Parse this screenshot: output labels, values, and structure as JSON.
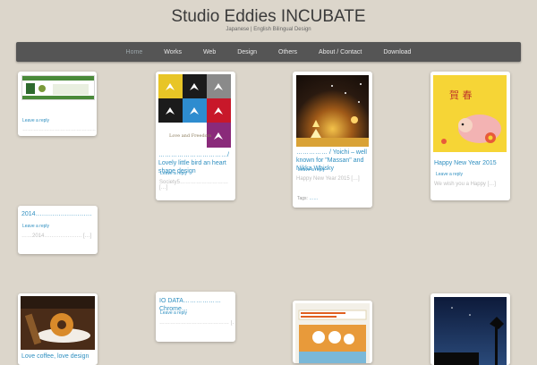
{
  "site": {
    "title": "Studio Eddies INCUBATE",
    "description": "Japanese | English Bilingual Design"
  },
  "nav": [
    "Home",
    "Works",
    "Web",
    "Design",
    "Others",
    "About / Contact",
    "Download"
  ],
  "cards": {
    "c1": {
      "reply": "Leave a reply",
      "excerpt": "…………………………………… […]"
    },
    "c2": {
      "title": "……………………………/ Lovely little bird an heart shape design",
      "reply": "Leave a reply",
      "excerpt": "Society5……………………… […]"
    },
    "c3": {
      "title": "…………… / Yoichi – well known for \"Massan\" and Nikka Whisky",
      "reply": "Leave a reply",
      "excerpt": "Happy New Year 2015 […]",
      "tags_label": "Tags:",
      "tag": "……"
    },
    "c4": {
      "title": "Happy New Year 2015",
      "reply": "Leave a reply",
      "excerpt": "We wish you a Happy […]"
    },
    "c5": {
      "title": "2014………………………",
      "reply": "Leave a reply",
      "excerpt": "……2014………………… […]"
    },
    "c6": {
      "title": "IO DATA………………Chrome…",
      "reply": "Leave a reply",
      "excerpt": "………………………………… […]"
    },
    "c7": {
      "title": "Love coffee, love design"
    }
  }
}
